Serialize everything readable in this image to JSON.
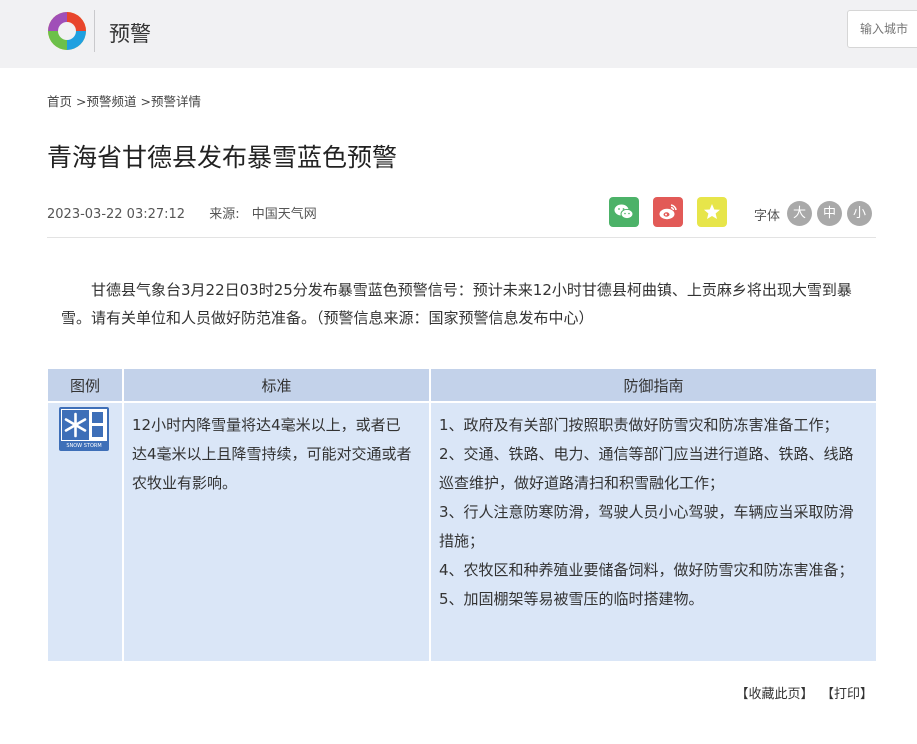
{
  "header": {
    "title": "预警",
    "search_placeholder": "输入城市"
  },
  "breadcrumb": [
    "首页",
    ">预警频道",
    ">预警详情"
  ],
  "article": {
    "title": "青海省甘德县发布暴雪蓝色预警",
    "datetime": "2023-03-22 03:27:12",
    "source_label": "来源:",
    "source_value": "中国天气网",
    "body": "甘德县气象台3月22日03时25分发布暴雪蓝色预警信号：预计未来12小时甘德县柯曲镇、上贡麻乡将出现大雪到暴雪。请有关单位和人员做好防范准备。（预警信息来源：国家预警信息发布中心）"
  },
  "share": {
    "icons": [
      "wechat-icon",
      "weibo-icon",
      "favorite-icon"
    ],
    "colors": {
      "wechat": "#4cb268",
      "weibo": "#e25a57",
      "favorite": "#e7e54a"
    }
  },
  "font_size": {
    "label": "字体",
    "large": "大",
    "medium": "中",
    "small": "小"
  },
  "table": {
    "headers": [
      "图例",
      "标准",
      "防御指南"
    ],
    "icon_text": "SNOW STORM",
    "icon_label": "暴雪蓝色预警图标",
    "standard": "12小时内降雪量将达4毫米以上，或者已达4毫米以上且降雪持续，可能对交通或者农牧业有影响。",
    "guide": [
      "1、政府及有关部门按照职责做好防雪灾和防冻害准备工作；",
      "2、交通、铁路、电力、通信等部门应当进行道路、铁路、线路巡查维护，做好道路清扫和积雪融化工作；",
      "3、行人注意防寒防滑，驾驶人员小心驾驶，车辆应当采取防滑措施；",
      "4、农牧区和种养殖业要储备饲料，做好防雪灾和防冻害准备；",
      "5、加固棚架等易被雪压的临时搭建物。"
    ]
  },
  "footer": {
    "bookmark": "【收藏此页】",
    "print": "【打印】"
  }
}
